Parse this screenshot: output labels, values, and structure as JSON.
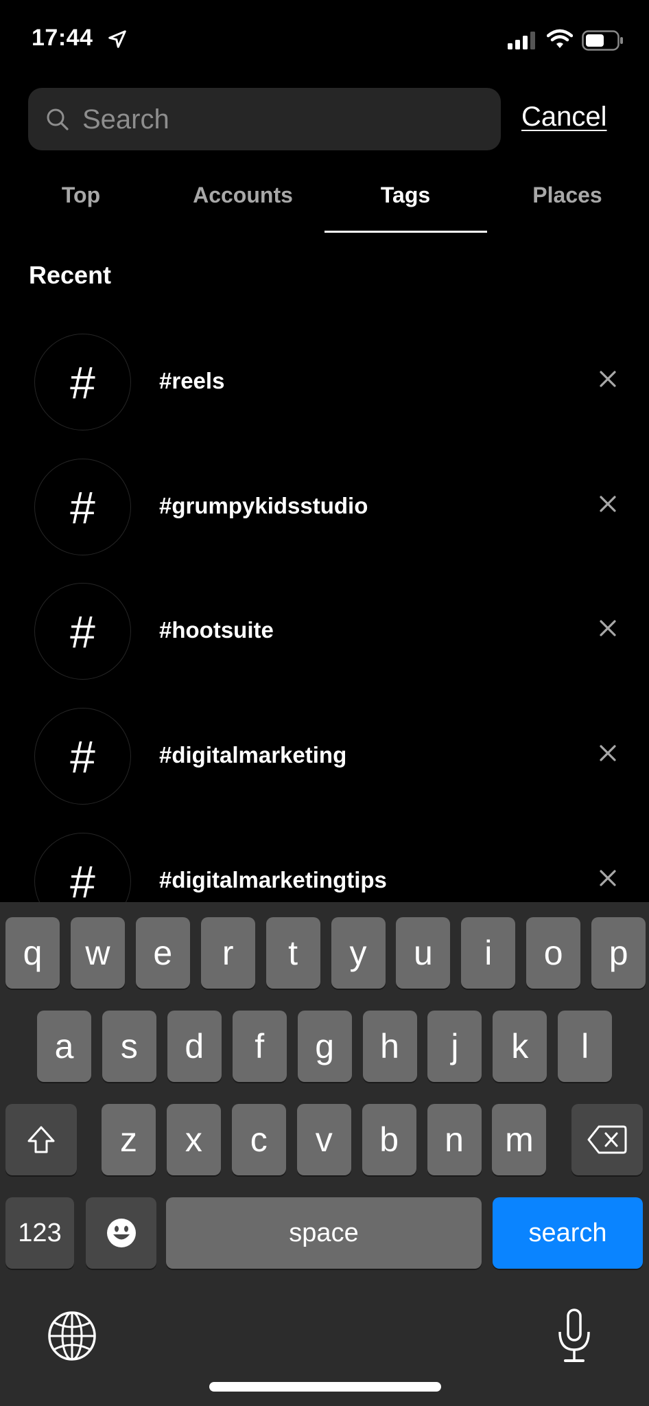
{
  "status_bar": {
    "time": "17:44",
    "icons": [
      "location-arrow-icon",
      "cellular-signal-icon",
      "wifi-icon",
      "battery-icon"
    ]
  },
  "search": {
    "placeholder": "Search",
    "value": "",
    "cancel_label": "Cancel"
  },
  "tabs": [
    {
      "label": "Top",
      "active": false
    },
    {
      "label": "Accounts",
      "active": false
    },
    {
      "label": "Tags",
      "active": true
    },
    {
      "label": "Places",
      "active": false
    }
  ],
  "recent": {
    "heading": "Recent",
    "items": [
      {
        "icon": "#",
        "label": "#reels"
      },
      {
        "icon": "#",
        "label": "#grumpykidsstudio"
      },
      {
        "icon": "#",
        "label": "#hootsuite"
      },
      {
        "icon": "#",
        "label": "#digitalmarketing"
      },
      {
        "icon": "#",
        "label": "#digitalmarketingtips"
      }
    ]
  },
  "keyboard": {
    "row1": [
      "q",
      "w",
      "e",
      "r",
      "t",
      "y",
      "u",
      "i",
      "o",
      "p"
    ],
    "row2": [
      "a",
      "s",
      "d",
      "f",
      "g",
      "h",
      "j",
      "k",
      "l"
    ],
    "row3": [
      "z",
      "x",
      "c",
      "v",
      "b",
      "n",
      "m"
    ],
    "numbers_label": "123",
    "space_label": "space",
    "return_label": "search",
    "return_color": "#0a84ff"
  }
}
